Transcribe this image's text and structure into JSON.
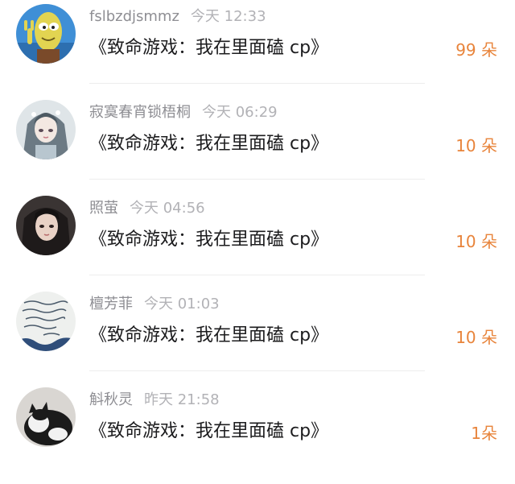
{
  "items": [
    {
      "username": "fslbzdjsmmz",
      "time": "今天 12:33",
      "title": "《致命游戏：我在里面磕 cp》",
      "gift": "99 朵",
      "avatar_icon": "cartoon-avatar-icon"
    },
    {
      "username": "寂寞春宵锁梧桐",
      "time": "今天 06:29",
      "title": "《致命游戏：我在里面磕 cp》",
      "gift": "10 朵",
      "avatar_icon": "anime-girl-avatar-icon"
    },
    {
      "username": "照萤",
      "time": "今天 04:56",
      "title": "《致命游戏：我在里面磕 cp》",
      "gift": "10 朵",
      "avatar_icon": "portrait-avatar-icon"
    },
    {
      "username": "檀芳菲",
      "time": "今天 01:03",
      "title": "《致命游戏：我在里面磕 cp》",
      "gift": "10 朵",
      "avatar_icon": "handwriting-avatar-icon"
    },
    {
      "username": "斛秋灵",
      "time": "昨天 21:58",
      "title": "《致命游戏：我在里面磕 cp》",
      "gift": "1朵",
      "avatar_icon": "cat-avatar-icon"
    }
  ],
  "colors": {
    "gift": "#e8843b",
    "username": "#8e8e93",
    "time": "#b2b2b6",
    "title": "#1c1c1e",
    "divider": "#ededed"
  }
}
